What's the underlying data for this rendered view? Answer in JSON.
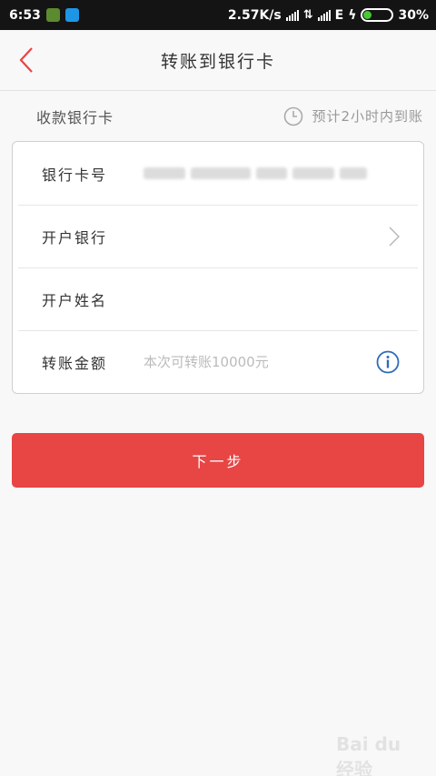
{
  "status_bar": {
    "time": "6:53",
    "net_speed": "2.57K/s",
    "network_type": "E",
    "battery_percent": "30%",
    "battery_level": 0.3,
    "app_icons": [
      "security-app-icon",
      "message-app-icon"
    ]
  },
  "header": {
    "title": "转账到银行卡",
    "back_icon": "chevron-left-icon",
    "accent_color": "#e84545"
  },
  "section": {
    "title": "收款银行卡",
    "eta_text": "预计2小时内到账",
    "eta_icon": "clock-icon"
  },
  "form": {
    "rows": [
      {
        "label": "银行卡号",
        "value": "",
        "note": "value obscured"
      },
      {
        "label": "开户银行",
        "value": "",
        "trailing_icon": "chevron-right-icon"
      },
      {
        "label": "开户姓名",
        "value": ""
      },
      {
        "label": "转账金额",
        "placeholder": "本次可转账10000元",
        "trailing_icon": "info-icon"
      }
    ]
  },
  "actions": {
    "next_label": "下一步",
    "next_color": "#e84545"
  },
  "watermark": {
    "text": "Bai du 经验"
  }
}
